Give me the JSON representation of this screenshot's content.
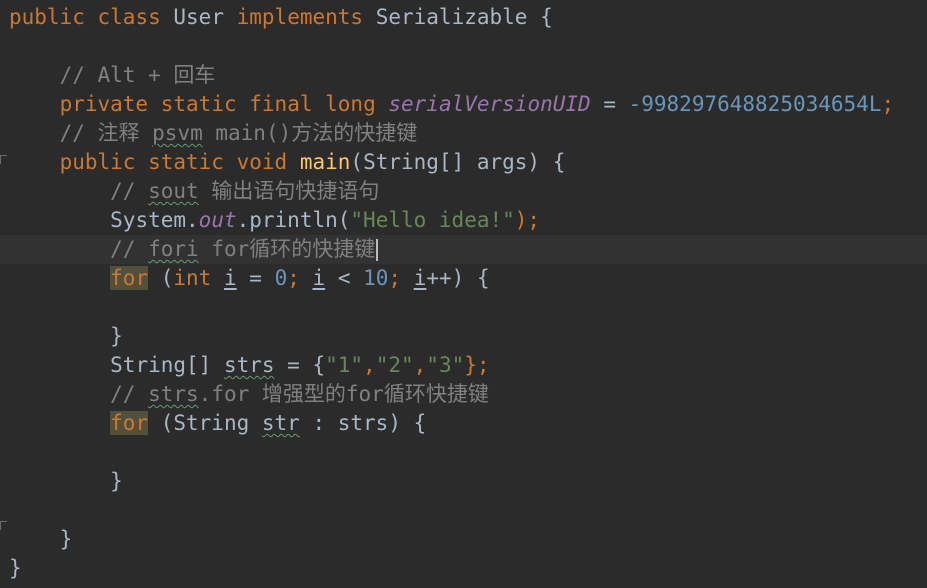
{
  "editor": {
    "lines": [
      {
        "indent": "",
        "tokens": [
          {
            "t": "public",
            "c": "kw"
          },
          {
            "t": " ",
            "c": "op"
          },
          {
            "t": "class",
            "c": "kw"
          },
          {
            "t": " ",
            "c": "op"
          },
          {
            "t": "User",
            "c": "id"
          },
          {
            "t": " ",
            "c": "op"
          },
          {
            "t": "implements",
            "c": "kw"
          },
          {
            "t": " ",
            "c": "op"
          },
          {
            "t": "Serializable",
            "c": "id"
          },
          {
            "t": " {",
            "c": "op"
          }
        ]
      },
      {
        "indent": "",
        "tokens": []
      },
      {
        "indent": "    ",
        "tokens": [
          {
            "t": "// Alt + 回车",
            "c": "cmt"
          }
        ]
      },
      {
        "indent": "    ",
        "tokens": [
          {
            "t": "private",
            "c": "kw"
          },
          {
            "t": " ",
            "c": "op"
          },
          {
            "t": "static",
            "c": "kw"
          },
          {
            "t": " ",
            "c": "op"
          },
          {
            "t": "final",
            "c": "kw"
          },
          {
            "t": " ",
            "c": "op"
          },
          {
            "t": "long",
            "c": "kw"
          },
          {
            "t": " ",
            "c": "op"
          },
          {
            "t": "serialVersionUID",
            "c": "field"
          },
          {
            "t": " = ",
            "c": "op"
          },
          {
            "t": "-998297648825034654L",
            "c": "num"
          },
          {
            "t": ";",
            "c": "kw"
          }
        ]
      },
      {
        "indent": "    ",
        "tokens": [
          {
            "t": "// 注释 ",
            "c": "cmt"
          },
          {
            "t": "psvm",
            "c": "cmt-typo"
          },
          {
            "t": " main()方法的快捷键",
            "c": "cmt"
          }
        ]
      },
      {
        "indent": "    ",
        "tokens": [
          {
            "t": "public",
            "c": "kw"
          },
          {
            "t": " ",
            "c": "op"
          },
          {
            "t": "static",
            "c": "kw"
          },
          {
            "t": " ",
            "c": "op"
          },
          {
            "t": "void",
            "c": "kw"
          },
          {
            "t": " ",
            "c": "op"
          },
          {
            "t": "main",
            "c": "fn"
          },
          {
            "t": "(String[] args) {",
            "c": "op"
          }
        ]
      },
      {
        "indent": "        ",
        "tokens": [
          {
            "t": "// ",
            "c": "cmt"
          },
          {
            "t": "sout",
            "c": "cmt-typo"
          },
          {
            "t": " 输出语句快捷语句",
            "c": "cmt"
          }
        ]
      },
      {
        "indent": "        ",
        "tokens": [
          {
            "t": "System.",
            "c": "op"
          },
          {
            "t": "out",
            "c": "field"
          },
          {
            "t": ".println(",
            "c": "op"
          },
          {
            "t": "\"Hello idea!\"",
            "c": "str"
          },
          {
            "t": ");",
            "c": "kw"
          }
        ]
      },
      {
        "indent": "        ",
        "current": true,
        "caret": true,
        "tokens": [
          {
            "t": "// ",
            "c": "cmt"
          },
          {
            "t": "fori",
            "c": "cmt-typo"
          },
          {
            "t": " for循环的快捷键",
            "c": "cmt"
          }
        ]
      },
      {
        "indent": "        ",
        "tokens": [
          {
            "t": "for",
            "c": "kw-hl"
          },
          {
            "t": " (",
            "c": "op"
          },
          {
            "t": "int",
            "c": "kw"
          },
          {
            "t": " ",
            "c": "op"
          },
          {
            "t": "i",
            "c": "local-ul"
          },
          {
            "t": " = ",
            "c": "op"
          },
          {
            "t": "0",
            "c": "num"
          },
          {
            "t": "; ",
            "c": "kw"
          },
          {
            "t": "i",
            "c": "local-ul"
          },
          {
            "t": " < ",
            "c": "op"
          },
          {
            "t": "10",
            "c": "num"
          },
          {
            "t": "; ",
            "c": "kw"
          },
          {
            "t": "i",
            "c": "local-ul"
          },
          {
            "t": "++) {",
            "c": "op"
          }
        ]
      },
      {
        "indent": "",
        "tokens": []
      },
      {
        "indent": "        ",
        "tokens": [
          {
            "t": "}",
            "c": "op"
          }
        ]
      },
      {
        "indent": "        ",
        "tokens": [
          {
            "t": "String[] ",
            "c": "op"
          },
          {
            "t": "strs",
            "c": "id-typo"
          },
          {
            "t": " = {",
            "c": "op"
          },
          {
            "t": "\"1\"",
            "c": "str"
          },
          {
            "t": ",",
            "c": "kw"
          },
          {
            "t": "\"2\"",
            "c": "str"
          },
          {
            "t": ",",
            "c": "kw"
          },
          {
            "t": "\"3\"",
            "c": "str"
          },
          {
            "t": "};",
            "c": "kw"
          }
        ]
      },
      {
        "indent": "        ",
        "tokens": [
          {
            "t": "// ",
            "c": "cmt"
          },
          {
            "t": "strs",
            "c": "cmt-typo"
          },
          {
            "t": ".for 增强型的for循环快捷键",
            "c": "cmt"
          }
        ]
      },
      {
        "indent": "        ",
        "tokens": [
          {
            "t": "for",
            "c": "kw-hl"
          },
          {
            "t": " (String ",
            "c": "op"
          },
          {
            "t": "str",
            "c": "id-typo"
          },
          {
            "t": " : strs) {",
            "c": "op"
          }
        ]
      },
      {
        "indent": "",
        "tokens": []
      },
      {
        "indent": "        ",
        "tokens": [
          {
            "t": "}",
            "c": "op"
          }
        ]
      },
      {
        "indent": "",
        "tokens": []
      },
      {
        "indent": "    ",
        "tokens": [
          {
            "t": "}",
            "c": "op"
          }
        ]
      },
      {
        "indent": "",
        "tokens": [
          {
            "t": "}",
            "c": "op"
          }
        ]
      }
    ]
  }
}
